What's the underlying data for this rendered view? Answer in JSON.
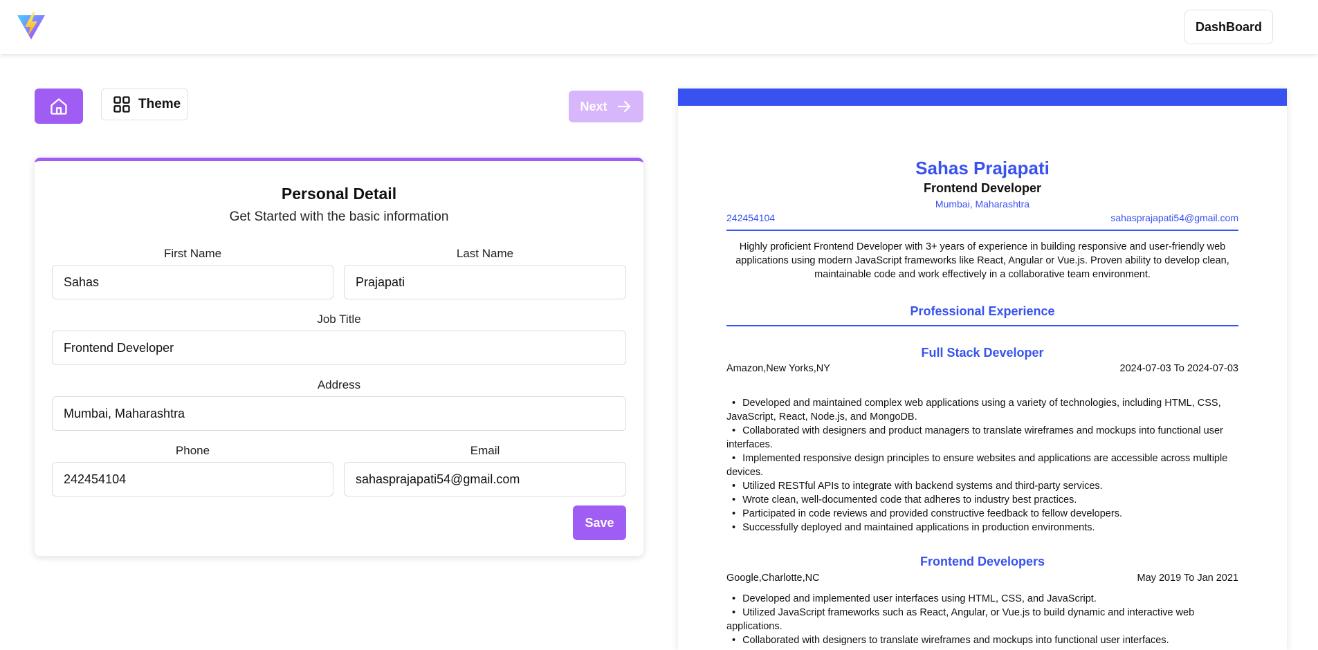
{
  "header": {
    "logo_icon": "bolt-triangle-logo-icon",
    "dashboard_label": "DashBoard"
  },
  "toolbar": {
    "home_icon": "home-icon",
    "theme_icon": "grid-icon",
    "theme_label": "Theme",
    "next_label": "Next",
    "next_icon": "arrow-right-icon"
  },
  "form": {
    "title": "Personal Detail",
    "subtitle": "Get Started with the basic information",
    "first_name": {
      "label": "First Name",
      "value": "Sahas"
    },
    "last_name": {
      "label": "Last Name",
      "value": "Prajapati"
    },
    "job_title": {
      "label": "Job Title",
      "value": "Frontend Developer"
    },
    "address": {
      "label": "Address",
      "value": "Mumbai, Maharashtra"
    },
    "phone": {
      "label": "Phone",
      "value": "242454104"
    },
    "email": {
      "label": "Email",
      "value": "sahasprajapati54@gmail.com"
    },
    "save_label": "Save"
  },
  "resume": {
    "theme_color": "#3752f0",
    "name": "Sahas Prajapati",
    "job_title": "Frontend Developer",
    "address": "Mumbai, Maharashtra",
    "phone": "242454104",
    "email": "sahasprajapati54@gmail.com",
    "summary": "Highly proficient Frontend Developer with 3+ years of experience in building responsive and user-friendly web applications using modern JavaScript frameworks like React, Angular or Vue.js. Proven ability to develop clean, maintainable code and work effectively in a collaborative team environment.",
    "section_experience": "Professional Experience",
    "experience": [
      {
        "title": "Full Stack Developer",
        "company": "Amazon,New Yorks,NY",
        "dates": "2024-07-03 To 2024-07-03",
        "bullets": [
          "Developed and maintained complex web applications using a variety of technologies, including HTML, CSS, JavaScript, React, Node.js, and MongoDB.",
          "Collaborated with designers and product managers to translate wireframes and mockups into functional user interfaces.",
          "Implemented responsive design principles to ensure websites and applications are accessible across multiple devices.",
          "Utilized RESTful APIs to integrate with backend systems and third-party services.",
          "Wrote clean, well-documented code that adheres to industry best practices.",
          "Participated in code reviews and provided constructive feedback to fellow developers.",
          "Successfully deployed and maintained applications in production environments."
        ]
      },
      {
        "title": "Frontend Developers",
        "company": "Google,Charlotte,NC",
        "dates": "May 2019 To Jan 2021",
        "bullets": [
          "Developed and implemented user interfaces using HTML, CSS, and JavaScript.",
          "Utilized JavaScript frameworks such as React, Angular, or Vue.js to build dynamic and interactive web applications.",
          "Collaborated with designers to translate wireframes and mockups into functional user interfaces."
        ]
      }
    ]
  }
}
